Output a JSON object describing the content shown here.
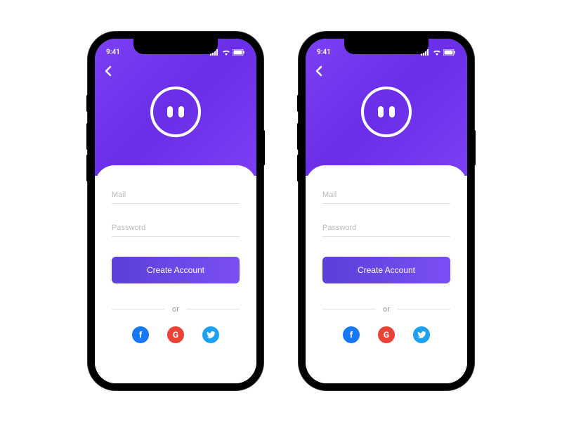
{
  "statusBar": {
    "time": "9:41"
  },
  "form": {
    "mailPlaceholder": "Mail",
    "passwordPlaceholder": "Password",
    "createButton": "Create Account",
    "dividerText": "or"
  },
  "social": {
    "facebook": "f",
    "google": "G",
    "twitter": ""
  }
}
